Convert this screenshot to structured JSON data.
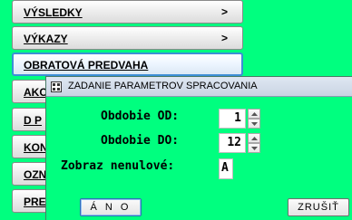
{
  "menu": {
    "items": [
      {
        "label": "VÝSLEDKY",
        "arrow": ">"
      },
      {
        "label": "VÝKAZY",
        "arrow": ">"
      },
      {
        "label": "OBRATOVÁ PREDVAHA",
        "arrow": ""
      },
      {
        "label": "AKC",
        "arrow": ""
      },
      {
        "label": "D P",
        "arrow": ""
      },
      {
        "label": "KON",
        "arrow": ""
      },
      {
        "label": "OZN",
        "arrow": ""
      },
      {
        "label": "PRE",
        "arrow": ""
      }
    ]
  },
  "dialog": {
    "title": "ZADANIE PARAMETROV SPRACOVANIA",
    "icon": "app-icon",
    "fields": {
      "obdobie_od": {
        "label": "Obdobie OD:",
        "value": "1"
      },
      "obdobie_do": {
        "label": "Obdobie DO:",
        "value": "12"
      },
      "nenulove": {
        "label": "Zobraz nenulové:",
        "value": "A"
      }
    },
    "buttons": {
      "ok": "Á N O",
      "cancel": "ZRUŠIŤ"
    }
  },
  "colors": {
    "background": "#00ff7f",
    "active_border": "#3c8fd6"
  }
}
